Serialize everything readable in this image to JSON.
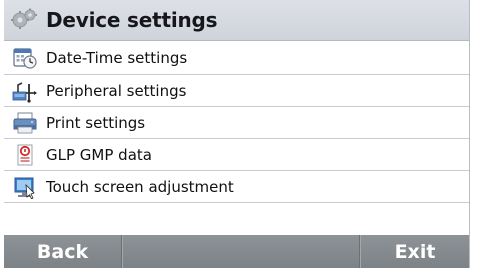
{
  "header": {
    "title": "Device settings",
    "icon": "gears-icon"
  },
  "menu": {
    "items": [
      {
        "label": "Date-Time settings",
        "icon": "calendar-clock-icon"
      },
      {
        "label": "Peripheral settings",
        "icon": "peripheral-icon"
      },
      {
        "label": "Print settings",
        "icon": "printer-icon"
      },
      {
        "label": "GLP GMP data",
        "icon": "glp-document-icon"
      },
      {
        "label": "Touch screen adjustment",
        "icon": "touch-screen-icon"
      }
    ]
  },
  "footer": {
    "back_label": "Back",
    "middle_label": "",
    "exit_label": "Exit"
  },
  "colors": {
    "header_bg": "#d6dae0",
    "footer_bg": "#868b90",
    "footer_text": "#ffffff",
    "row_divider": "#c7cbd0"
  }
}
